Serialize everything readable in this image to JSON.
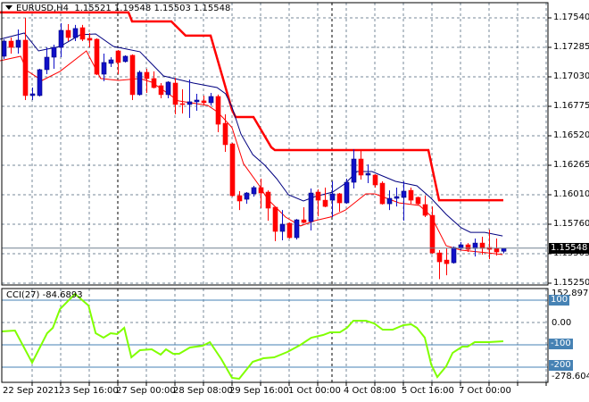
{
  "header": {
    "symbol": "EURUSD,H4",
    "open": "1.15521",
    "high": "1.19548",
    "low": "1.15503",
    "close": "1.15548"
  },
  "price_axis": [
    "1.17540",
    "1.17285",
    "1.17030",
    "1.16775",
    "1.16520",
    "1.16265",
    "1.16010",
    "1.15760",
    "1.15505",
    "1.15250"
  ],
  "current_price": "1.15548",
  "cci": {
    "title": "CCI(27)",
    "value": "-84.6893",
    "max_label": "152.8971",
    "min_label": "-278.6043",
    "levels": [
      "100",
      "0.00",
      "-100",
      "-200"
    ]
  },
  "time_axis": [
    "22 Sep 2021",
    "23 Sep 16:00",
    "27 Sep 00:00",
    "28 Sep 08:00",
    "29 Sep 16:00",
    "1 Oct 00:00",
    "4 Oct 08:00",
    "5 Oct 16:00",
    "7 Oct 00:00"
  ],
  "colors": {
    "bull": "#1010c8",
    "bear": "#ff0000",
    "ma_slow": "#000080",
    "ma_fast": "#ff0000",
    "stop": "#ff0000",
    "cci": "#80ff00",
    "level": "#4682b4",
    "grid": "#778899"
  },
  "chart_data": {
    "type": "candlestick",
    "title": "EURUSD,H4",
    "ylim": [
      1.1525,
      1.177
    ],
    "ohlc": [
      [
        1.17208,
        1.17355,
        1.17185,
        1.17339
      ],
      [
        1.17339,
        1.1737,
        1.17231,
        1.17285
      ],
      [
        1.17285,
        1.1744,
        1.17231,
        1.17347
      ],
      [
        1.17347,
        1.1754,
        1.16829,
        1.16868
      ],
      [
        1.16868,
        1.16937,
        1.16829,
        1.16883
      ],
      [
        1.16868,
        1.171,
        1.1686,
        1.17092
      ],
      [
        1.17092,
        1.17285,
        1.17053,
        1.172
      ],
      [
        1.172,
        1.17308,
        1.171,
        1.17285
      ],
      [
        1.17285,
        1.17494,
        1.172,
        1.17432
      ],
      [
        1.17432,
        1.17486,
        1.17339,
        1.1737
      ],
      [
        1.1737,
        1.17479,
        1.17339,
        1.17448
      ],
      [
        1.17455,
        1.17479,
        1.17339,
        1.17355
      ],
      [
        1.17363,
        1.17409,
        1.17285,
        1.17347
      ],
      [
        1.17355,
        1.17363,
        1.17045,
        1.17053
      ],
      [
        1.17053,
        1.17231,
        1.16992,
        1.17154
      ],
      [
        1.17146,
        1.172,
        1.17115,
        1.17177
      ],
      [
        1.17254,
        1.17262,
        1.17053,
        1.17154
      ],
      [
        1.17162,
        1.17216,
        1.17154,
        1.17208
      ],
      [
        1.17216,
        1.17224,
        1.16829,
        1.16876
      ],
      [
        1.16876,
        1.17084,
        1.16868,
        1.17069
      ],
      [
        1.17069,
        1.171,
        1.16891,
        1.17015
      ],
      [
        1.17015,
        1.17077,
        1.1693,
        1.16937
      ],
      [
        1.16953,
        1.16976,
        1.16845,
        1.16876
      ],
      [
        1.16876,
        1.16992,
        1.16845,
        1.16984
      ],
      [
        1.16976,
        1.1702,
        1.16705,
        1.16791
      ],
      [
        1.16798,
        1.16922,
        1.16713,
        1.16791
      ],
      [
        1.16791,
        1.17007,
        1.16675,
        1.16814
      ],
      [
        1.16814,
        1.16883,
        1.16736,
        1.16829
      ],
      [
        1.16822,
        1.16868,
        1.16783,
        1.16806
      ],
      [
        1.16806,
        1.16891,
        1.16783,
        1.1686
      ],
      [
        1.1686,
        1.16876,
        1.16551,
        1.1662
      ],
      [
        1.16628,
        1.16705,
        1.16381,
        1.16443
      ],
      [
        1.1645,
        1.16458,
        1.15995,
        1.16002
      ],
      [
        1.16002,
        1.16041,
        1.15878,
        1.15956
      ],
      [
        1.15971,
        1.16033,
        1.15932,
        1.16025
      ],
      [
        1.16018,
        1.16087,
        1.15994,
        1.16072
      ],
      [
        1.16072,
        1.16149,
        1.15894,
        1.16025
      ],
      [
        1.16033,
        1.16048,
        1.15786,
        1.15894
      ],
      [
        1.15902,
        1.1591,
        1.15608,
        1.15693
      ],
      [
        1.15693,
        1.15878,
        1.15616,
        1.15755
      ],
      [
        1.15763,
        1.1577,
        1.15631,
        1.15639
      ],
      [
        1.15639,
        1.158,
        1.15623,
        1.15793
      ],
      [
        1.15793,
        1.15902,
        1.15763,
        1.1577
      ],
      [
        1.15778,
        1.16064,
        1.15701,
        1.16025
      ],
      [
        1.16033,
        1.16056,
        1.15824,
        1.15963
      ],
      [
        1.15963,
        1.16072,
        1.15902,
        1.15909
      ],
      [
        1.15963,
        1.16126,
        1.15817,
        1.16018
      ],
      [
        1.16018,
        1.16025,
        1.15863,
        1.1594
      ],
      [
        1.1594,
        1.16149,
        1.15932,
        1.16118
      ],
      [
        1.16118,
        1.16404,
        1.16064,
        1.16319
      ],
      [
        1.16319,
        1.16396,
        1.16141,
        1.1618
      ],
      [
        1.1618,
        1.16273,
        1.1611,
        1.16195
      ],
      [
        1.1618,
        1.16188,
        1.16072,
        1.16095
      ],
      [
        1.1611,
        1.16126,
        1.15925,
        1.15932
      ],
      [
        1.15932,
        1.16048,
        1.15878,
        1.15979
      ],
      [
        1.15979,
        1.16072,
        1.15909,
        1.15994
      ],
      [
        1.15987,
        1.16126,
        1.15786,
        1.16041
      ],
      [
        1.16048,
        1.16072,
        1.15932,
        1.15963
      ],
      [
        1.15987,
        1.15994,
        1.15917,
        1.15932
      ],
      [
        1.15925,
        1.16002,
        1.15817,
        1.15832
      ],
      [
        1.15832,
        1.15909,
        1.155,
        1.15507
      ],
      [
        1.15507,
        1.15531,
        1.1528,
        1.1543
      ],
      [
        1.15445,
        1.15546,
        1.15314,
        1.15414
      ],
      [
        1.15422,
        1.15562,
        1.15414,
        1.15554
      ],
      [
        1.15546,
        1.156,
        1.15531,
        1.15577
      ],
      [
        1.15577,
        1.15592,
        1.15515,
        1.15538
      ],
      [
        1.15546,
        1.15631,
        1.15476,
        1.15592
      ],
      [
        1.15592,
        1.15647,
        1.15492,
        1.15546
      ],
      [
        1.15554,
        1.15708,
        1.15453,
        1.15538
      ],
      [
        1.15546,
        1.15631,
        1.15484,
        1.15515
      ],
      [
        1.15521,
        1.15548,
        1.15503,
        1.15548
      ]
    ],
    "ma_slow": [
      [
        -0.5,
        1.17355
      ],
      [
        2.9,
        1.17409
      ],
      [
        4.9,
        1.17254
      ],
      [
        7.9,
        1.17293
      ],
      [
        10.75,
        1.17394
      ],
      [
        12.9,
        1.17401
      ],
      [
        15.4,
        1.17293
      ],
      [
        19.1,
        1.17247
      ],
      [
        22.4,
        1.17038
      ],
      [
        26.6,
        1.16976
      ],
      [
        29.9,
        1.16937
      ],
      [
        31.1,
        1.16883
      ],
      [
        32,
        1.16767
      ],
      [
        33.25,
        1.16535
      ],
      [
        34.9,
        1.16358
      ],
      [
        36.6,
        1.16265
      ],
      [
        38.25,
        1.16149
      ],
      [
        39.9,
        1.1601
      ],
      [
        42,
        1.15956
      ],
      [
        43.6,
        1.15994
      ],
      [
        46.1,
        1.16033
      ],
      [
        47.9,
        1.1611
      ],
      [
        49.5,
        1.16211
      ],
      [
        51.6,
        1.16211
      ],
      [
        54.9,
        1.16126
      ],
      [
        57.9,
        1.16087
      ],
      [
        59.9,
        1.15979
      ],
      [
        62,
        1.1584
      ],
      [
        64.1,
        1.15724
      ],
      [
        65.4,
        1.15685
      ],
      [
        67.4,
        1.15685
      ],
      [
        69.9,
        1.15654
      ]
    ],
    "ma_fast": [
      [
        -0.5,
        1.17169
      ],
      [
        2.4,
        1.17208
      ],
      [
        3.25,
        1.17084
      ],
      [
        5.4,
        1.16999
      ],
      [
        7.9,
        1.17077
      ],
      [
        11.6,
        1.17254
      ],
      [
        13.6,
        1.17015
      ],
      [
        16.1,
        1.16999
      ],
      [
        19.1,
        1.17015
      ],
      [
        20.75,
        1.16984
      ],
      [
        24.5,
        1.16822
      ],
      [
        28.6,
        1.16783
      ],
      [
        29.9,
        1.16729
      ],
      [
        30.75,
        1.16675
      ],
      [
        32,
        1.1659
      ],
      [
        33.6,
        1.1628
      ],
      [
        35.75,
        1.16095
      ],
      [
        37,
        1.15971
      ],
      [
        39.5,
        1.15817
      ],
      [
        41.6,
        1.1574
      ],
      [
        43.6,
        1.15786
      ],
      [
        45.75,
        1.15817
      ],
      [
        47.9,
        1.15878
      ],
      [
        50.75,
        1.16018
      ],
      [
        52,
        1.16018
      ],
      [
        55.4,
        1.1594
      ],
      [
        58.25,
        1.15917
      ],
      [
        59.9,
        1.15824
      ],
      [
        62,
        1.15569
      ],
      [
        64.1,
        1.15531
      ],
      [
        67.9,
        1.15507
      ],
      [
        69.9,
        1.15492
      ]
    ],
    "stop_line": [
      [
        -0.5,
        1.17587
      ],
      [
        17.5,
        1.17587
      ],
      [
        18,
        1.17509
      ],
      [
        23.5,
        1.17509
      ],
      [
        25.5,
        1.17386
      ],
      [
        29,
        1.17386
      ],
      [
        32,
        1.16744
      ],
      [
        32.5,
        1.16682
      ],
      [
        35,
        1.16682
      ],
      [
        37.5,
        1.1642
      ],
      [
        38,
        1.16396
      ],
      [
        59.5,
        1.16396
      ],
      [
        61,
        1.15963
      ],
      [
        70,
        1.15963
      ]
    ],
    "cci_series": [
      [
        -0.25,
        -40
      ],
      [
        1.6,
        -36
      ],
      [
        4,
        -180
      ],
      [
        6.1,
        -48
      ],
      [
        6.9,
        -24
      ],
      [
        7.9,
        60
      ],
      [
        10,
        128
      ],
      [
        11.9,
        76
      ],
      [
        12.9,
        -48
      ],
      [
        14,
        -68
      ],
      [
        15,
        -48
      ],
      [
        15.9,
        -52
      ],
      [
        16.9,
        -24
      ],
      [
        17.9,
        -156
      ],
      [
        19.1,
        -124
      ],
      [
        20.75,
        -120
      ],
      [
        22,
        -144
      ],
      [
        22.75,
        -120
      ],
      [
        23.75,
        -140
      ],
      [
        24.6,
        -140
      ],
      [
        26.1,
        -112
      ],
      [
        27.9,
        -104
      ],
      [
        28.9,
        -88
      ],
      [
        30.5,
        -164
      ],
      [
        32,
        -248
      ],
      [
        33,
        -252
      ],
      [
        34.9,
        -176
      ],
      [
        36.4,
        -160
      ],
      [
        37.9,
        -156
      ],
      [
        39.75,
        -132
      ],
      [
        41.6,
        -100
      ],
      [
        43.1,
        -68
      ],
      [
        44.75,
        -56
      ],
      [
        45.75,
        -44
      ],
      [
        47.1,
        -44
      ],
      [
        48.1,
        -24
      ],
      [
        49,
        8
      ],
      [
        50.75,
        8
      ],
      [
        51.9,
        -4
      ],
      [
        53.1,
        -32
      ],
      [
        54.5,
        -32
      ],
      [
        56,
        -12
      ],
      [
        57.1,
        -8
      ],
      [
        57.9,
        -24
      ],
      [
        59,
        -68
      ],
      [
        59.9,
        -188
      ],
      [
        60.75,
        -244
      ],
      [
        62,
        -196
      ],
      [
        62.9,
        -136
      ],
      [
        64.25,
        -108
      ],
      [
        65,
        -108
      ],
      [
        66,
        -88
      ],
      [
        67.9,
        -88
      ],
      [
        70,
        -84
      ]
    ],
    "cci_range": [
      -278.6043,
      152.8971
    ]
  }
}
